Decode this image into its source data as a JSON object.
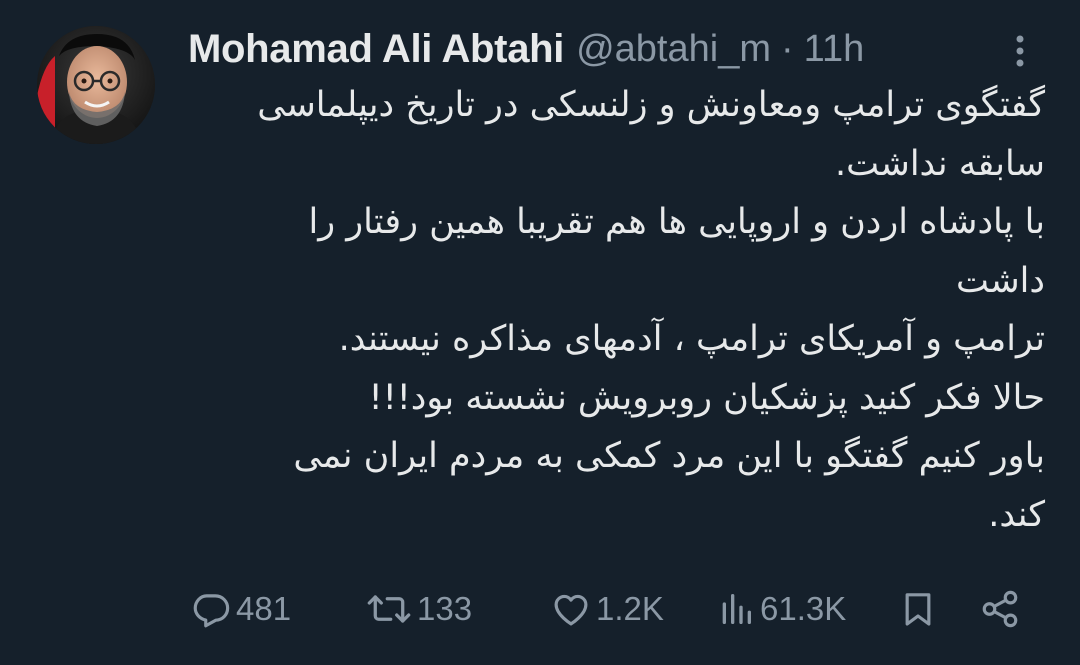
{
  "tweet": {
    "author": {
      "display_name": "Mohamad Ali Abtahi",
      "handle": "@abtahi_m",
      "separator": "·",
      "time": "11h"
    },
    "text_lines": [
      "گفتگوی ترامپ ومعاونش و زلنسکی در تاریخ دیپلماسی",
      "سابقه نداشت.",
      "با پادشاه اردن و اروپایی ها هم تقریبا همین رفتار را",
      "داشت",
      "ترامپ و آمریکای ترامپ ، آدمهای مذاکره نیستند.",
      "حالا فکر کنید پزشکیان روبرویش نشسته بود!!!",
      "باور کنیم گفتگو با این مرد کمکی به مردم ایران نمی",
      "کند."
    ],
    "actions": {
      "replies": "481",
      "retweets": "133",
      "likes": "1.2K",
      "views": "61.3K"
    }
  },
  "icons": {
    "more": "more-vertical-icon",
    "reply": "reply-icon",
    "retweet": "retweet-icon",
    "like": "heart-icon",
    "views": "views-icon",
    "bookmark": "bookmark-icon",
    "share": "share-icon"
  },
  "colors": {
    "background": "#15202b",
    "text_primary": "#e7e9ea",
    "text_secondary": "#8b98a5",
    "avatar_ring": "#e0242d"
  }
}
